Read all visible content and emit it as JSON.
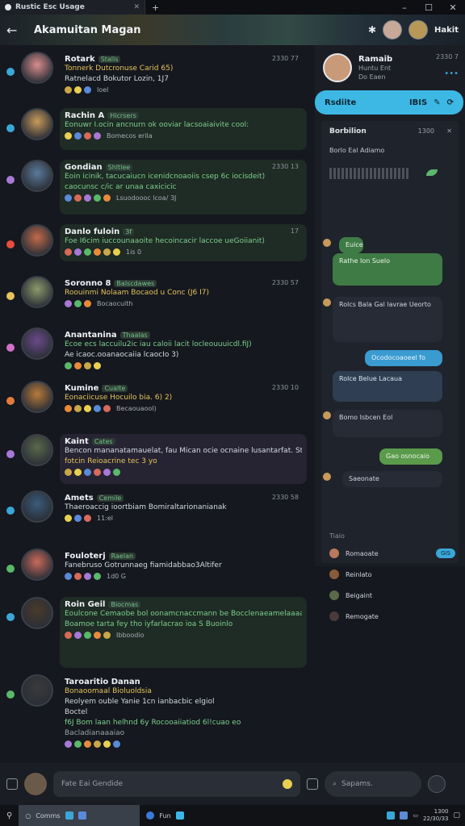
{
  "window": {
    "tab_title": "Rustic Esc Usage",
    "minimize": "–",
    "maximize": "☐",
    "close": "✕"
  },
  "header": {
    "title": "Akamuitan Magan",
    "back_icon": "←",
    "user_name": "Hakit"
  },
  "messages": [
    {
      "name": "Rotark",
      "role": "Stalls",
      "time": "2330 77",
      "lines": [
        {
          "t": "Tonnerk Dutcronuse Carid 65)",
          "c": "c-yellow"
        },
        {
          "t": "Ratnelacd Bokutor Lozin, 1J7",
          "c": "c-white"
        }
      ],
      "react": "Ioel",
      "color": "#d98c8c",
      "bubble": "b-plain",
      "side": "#3aa7d8"
    },
    {
      "name": "Rachin A",
      "role": "Hicrsers",
      "time": "",
      "lines": [
        {
          "t": "Eonuwr I.ocin ancnurn ok ooviar lacsoaiaivite cool:",
          "c": "c-green"
        }
      ],
      "react": "Bomecos erila",
      "color": "#c89a5a",
      "bubble": "b-green",
      "side": "#3aa7d8"
    },
    {
      "name": "Gondian",
      "role": "Shltlee",
      "time": "2330 13",
      "lines": [
        {
          "t": "Eoin icinik, tacucaiucn icenidcnoaoiis csep 6c iocisdeit)",
          "c": "c-green"
        },
        {
          "t": "caocunsc c/ic ar unaa caxicicic",
          "c": "c-green"
        }
      ],
      "react": "Lsuodoooc lcoa/ 3J",
      "color": "#5a7a9a",
      "bubble": "b-green",
      "side": "#a878d8"
    },
    {
      "name": "Danlo fuloin",
      "role": "3f",
      "time": "17",
      "lines": [
        {
          "t": "Foe I6cim iuccounaaoite hecoincacir laccoe ueGoiianit)",
          "c": "c-green"
        }
      ],
      "react": "1is 0",
      "color": "#c26a4a",
      "bubble": "b-green",
      "side": "#e84c3c"
    },
    {
      "name": "Soronno 8",
      "role": "Balscdawes",
      "time": "2330 57",
      "lines": [
        {
          "t": "Roouinmi Nolaam Bocaod u Conc (J6 I7)",
          "c": "c-yellow"
        }
      ],
      "react": "Bocaocuith",
      "color": "#8a9a6a",
      "bubble": "b-plain",
      "side": "#e6c35c"
    },
    {
      "name": "Anantanina",
      "role": "Thaalas",
      "time": "",
      "lines": [
        {
          "t": "Ecoe ecs laccuilu2ic iau caloii lacit locleouuuicdl.fiJ)",
          "c": "c-green"
        },
        {
          "t": "Ae icaoc.ooanaocaiia lcaocIo 3)",
          "c": "c-white"
        }
      ],
      "react": "",
      "color": "#6a4a8a",
      "bubble": "b-plain",
      "side": "#d070c8"
    },
    {
      "name": "Kumine",
      "role": "Cualte",
      "time": "2330 10",
      "lines": [
        {
          "t": "Eonaciicuse Hocuilo bia. 6) 2)",
          "c": "c-yellow"
        }
      ],
      "react": "Becaouaool)",
      "color": "#b87a3a",
      "bubble": "b-plain",
      "side": "#e67a3a"
    },
    {
      "name": "Kaint",
      "role": "Cates",
      "time": "",
      "lines": [
        {
          "t": "Bencon mananatamauelat, fau Mican ocie ocnaine lusantarfat. Stay",
          "c": "c-white"
        },
        {
          "t": "fotcin  Reioacrine tec 3 yo",
          "c": "c-yellow"
        }
      ],
      "react": "",
      "color": "#5a6a4a",
      "bubble": "b-purple",
      "side": "#a878d8"
    },
    {
      "name": "Amets",
      "role": "Cemile",
      "time": "2330 58",
      "lines": [
        {
          "t": "Thaeroaccig ioortbiam Bomiraltarionanianak",
          "c": "c-white"
        }
      ],
      "react": "11:el",
      "color": "#3a5a7a",
      "bubble": "b-plain",
      "side": "#3aa7d8"
    },
    {
      "name": "Fouloterj",
      "role": "Raelan",
      "time": "",
      "lines": [
        {
          "t": "Fanebruso Gotrunnaeg fiamidabbao3Altifer",
          "c": "c-white"
        }
      ],
      "react": "1d0 G",
      "color": "#c86a5a",
      "bubble": "b-plain",
      "side": "#5ab86a"
    },
    {
      "name": "Roin Geil",
      "role": "Biocmas",
      "time": "",
      "lines": [
        {
          "t": "Eoulcone Cemaobe bol oonamcnaccmann be Bocclenaeamelaaaadio",
          "c": "c-green"
        },
        {
          "t": "Boamoe tarta fey tho iyfarlacrao ioa S Buoinlo",
          "c": "c-green"
        }
      ],
      "react": "Ibboodio",
      "color": "#4a3a2a",
      "bubble": "b-green",
      "side": "#3aa7d8"
    },
    {
      "name": "Taroaritio Danan",
      "role": "",
      "time": "",
      "lines": [
        {
          "t": "Bonaoomaal   Bioluoldsia",
          "c": "c-yellow"
        },
        {
          "t": "Reolyem ouble Yanie 1cn ianbacbic elgiol",
          "c": "c-white"
        },
        {
          "t": "Boctel",
          "c": "c-white"
        },
        {
          "t": "f6J  Bom laan helhnd 6y Rocooaiiatiod 6l!cuao eo",
          "c": "c-green"
        },
        {
          "t": "Bacladianaaaiao",
          "c": "c-gray"
        }
      ],
      "react": "",
      "color": "#3a3a3a",
      "bubble": "b-plain",
      "side": "#5ab86a"
    }
  ],
  "right_panel": {
    "user_name": "Ramaib",
    "status_lines": [
      "Huntu Ent",
      "Do Eaen"
    ],
    "time": "2330 7",
    "cta_label": "Rsdiite",
    "cta_right": "IBIS",
    "thread": {
      "title": "Borbilion",
      "time": "1300",
      "subtitle": "Borlo Eal Adiamo",
      "bubbles": [
        {
          "text": "Euice",
          "cls": "rb-green"
        },
        {
          "text": "Rathe Ion Suelo",
          "cls": "rb-green"
        },
        {
          "text": "Rolcs Bala Gal lavrae Ueorto",
          "cls": "rb-dark"
        },
        {
          "text": "Ocodocoaoeel fo",
          "cls": "rb-blue"
        },
        {
          "text": "Rolce Belue Lacaua",
          "cls": "rb-slate"
        },
        {
          "text": "Bomo Isbcen Eol",
          "cls": "rb-dark"
        },
        {
          "text": "Gao osnocaio",
          "cls": "rb-lime"
        },
        {
          "text": "Saeonate",
          "cls": "rb-dark"
        }
      ],
      "members_title": "Tiaio",
      "members": [
        {
          "name": "Romaoate",
          "pill": "GIS",
          "color": "#b87a5a"
        },
        {
          "name": "Reinlato",
          "pill": "",
          "color": "#8a5a3a"
        },
        {
          "name": "Beigaint",
          "pill": "",
          "color": "#5a6a4a"
        },
        {
          "name": "Remogate",
          "pill": "",
          "color": "#4a3a3a"
        }
      ]
    }
  },
  "composer": {
    "placeholder": "Fate Eai Gendide",
    "search_placeholder": "Sapams."
  },
  "taskbar": {
    "item1": "Comms",
    "item2": "Fun",
    "time": "1300",
    "date": "22/30/33"
  }
}
